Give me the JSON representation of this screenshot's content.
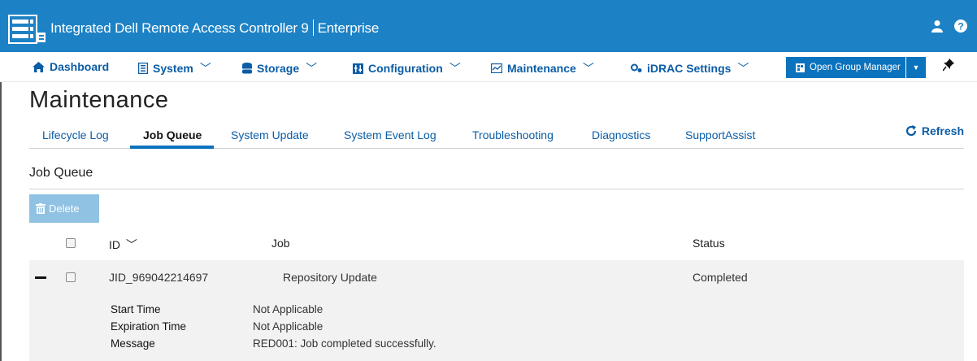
{
  "header": {
    "title": "Integrated Dell Remote Access Controller 9",
    "edition": "Enterprise",
    "icons": [
      "server-logo-icon",
      "user-icon",
      "help-icon"
    ]
  },
  "nav": {
    "items": [
      {
        "label": "Dashboard",
        "icon": "home-icon"
      },
      {
        "label": "System",
        "icon": "system-icon"
      },
      {
        "label": "Storage",
        "icon": "storage-icon"
      },
      {
        "label": "Configuration",
        "icon": "configuration-icon"
      },
      {
        "label": "Maintenance",
        "icon": "maintenance-icon"
      },
      {
        "label": "iDRAC Settings",
        "icon": "settings-icon"
      }
    ],
    "group_manager_label": "Open Group Manager",
    "pin_icon": "pin-icon"
  },
  "page": {
    "title": "Maintenance",
    "tabs": [
      {
        "label": "Lifecycle Log"
      },
      {
        "label": "Job Queue"
      },
      {
        "label": "System Update"
      },
      {
        "label": "System Event Log"
      },
      {
        "label": "Troubleshooting"
      },
      {
        "label": "Diagnostics"
      },
      {
        "label": "SupportAssist"
      }
    ],
    "active_tab": "Job Queue",
    "refresh_label": "Refresh"
  },
  "job_queue": {
    "section_title": "Job Queue",
    "delete_label": "Delete",
    "columns": {
      "id": "ID",
      "job": "Job",
      "status": "Status"
    },
    "rows": [
      {
        "id": "JID_969042214697",
        "job": "Repository Update",
        "status": "Completed",
        "details": [
          {
            "label": "Start Time",
            "value": "Not Applicable"
          },
          {
            "label": "Expiration Time",
            "value": "Not Applicable"
          },
          {
            "label": "Message",
            "value": "RED001: Job completed successfully."
          }
        ]
      }
    ]
  },
  "colors": {
    "header_bg": "#1d82c5",
    "link": "#0b5da6",
    "accent": "#0b72bd",
    "delete_disabled": "#8fc2e3"
  }
}
